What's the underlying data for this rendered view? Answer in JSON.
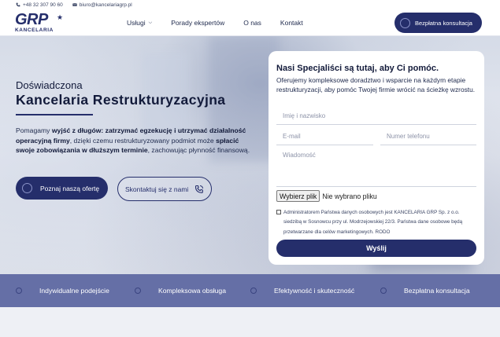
{
  "topbar": {
    "phone": "+48 32 307 90 60",
    "email": "biuro@kancelariagrp.pl",
    "phone_icon": "phone-icon",
    "email_icon": "envelope-icon"
  },
  "header": {
    "logo_main": "GRP",
    "logo_sub": "KANCELARIA",
    "nav": [
      {
        "label": "Usługi",
        "has_dropdown": true
      },
      {
        "label": "Porady ekspertów"
      },
      {
        "label": "O nas"
      },
      {
        "label": "Kontakt"
      }
    ],
    "cta_label": "Bezpłatna konsultacja"
  },
  "hero": {
    "subtitle": "Doświadczona",
    "title": "Kancelaria Restrukturyzacyjna",
    "desc_1": "Pomagamy ",
    "desc_b1": "wyjść z długów: zatrzymać egzekucję i utrzymać działalność operacyjną firmy",
    "desc_2": ", dzięki czemu restrukturyzowany podmiot może ",
    "desc_b2": "spłacić swoje zobowiązania w dłuższym terminie",
    "desc_3": ", zachowując płynność finansową.",
    "btn_offer": "Poznaj naszą ofertę",
    "btn_contact": "Skontaktuj się z nami"
  },
  "form": {
    "title": "Nasi Specjaliści są tutaj, aby Ci pomóc.",
    "desc": "Oferujemy kompleksowe doradztwo i wsparcie na każdym etapie restrukturyzacji, aby pomóc Twojej firmie wrócić na ścieżkę wzrostu.",
    "name_placeholder": "Imię i nazwisko",
    "email_placeholder": "E-mail",
    "phone_placeholder": "Numer telefonu",
    "message_placeholder": "Wiadomość",
    "file_button": "Wybierz plik",
    "file_status": "Nie wybrano pliku",
    "consent": "Administratorem Państwa danych osobowych jest KANCELARIA GRP Sp. z o.o. siedzibą w Sosnowcu przy ul. Modrzejowskiej 22/3. Państwa dane osobowe będą przetwarzane dla celów marketingowych. RODO",
    "submit": "Wyślij"
  },
  "features": [
    "Indywidualne podejście",
    "Kompleksowa obsługa",
    "Efektywność i skuteczność",
    "Bezpłatna konsultacja"
  ],
  "colors": {
    "brand_navy": "#252e6b",
    "feature_bar": "#656fa6",
    "text_dark": "#121a3a"
  }
}
